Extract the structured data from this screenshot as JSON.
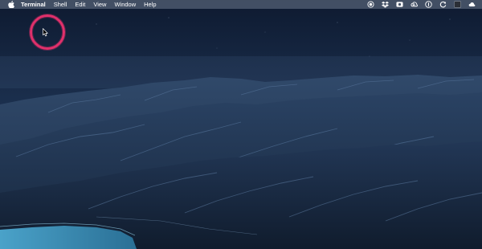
{
  "menubar": {
    "apple_icon": "apple-logo-icon",
    "app_name": "Terminal",
    "items": [
      "Shell",
      "Edit",
      "View",
      "Window",
      "Help"
    ],
    "status_icons": [
      "record-icon",
      "dropbox-icon",
      "screen-record-icon",
      "creative-cloud-icon",
      "1password-icon",
      "sync-icon",
      "app-square-icon",
      "cloud-icon"
    ]
  },
  "colors": {
    "menubar_bg": "#465468",
    "cursor_ring": "#e0306b",
    "sky_top": "#0f1c33",
    "mountains": "#1d2f49",
    "water": "#3d8fb8"
  }
}
